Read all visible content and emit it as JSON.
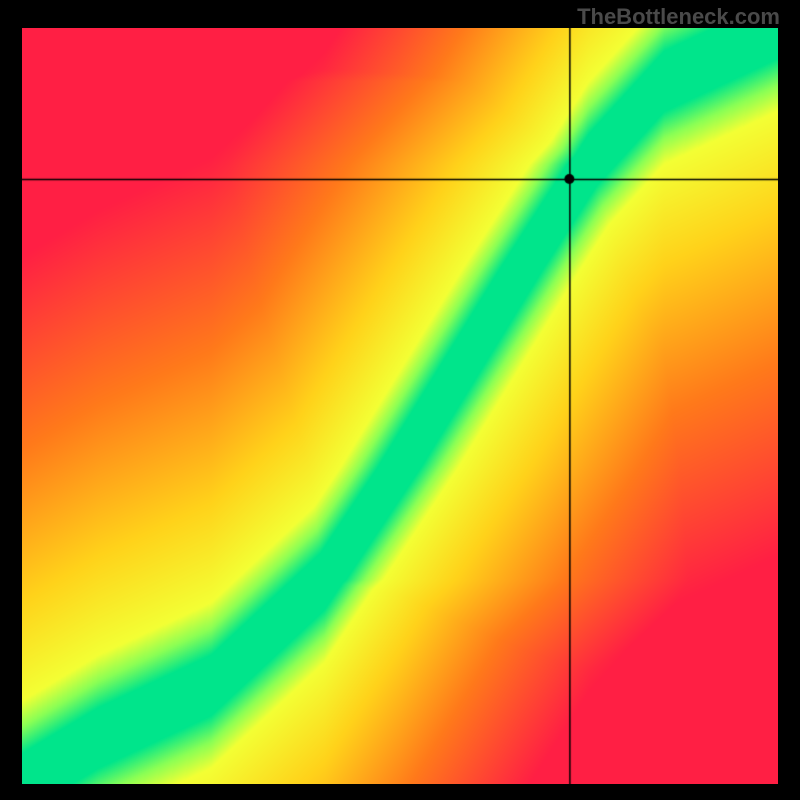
{
  "watermark": "TheBottleneck.com",
  "chart_data": {
    "type": "heatmap",
    "title": "",
    "xlabel": "",
    "ylabel": "",
    "xlim": [
      0,
      100
    ],
    "ylim": [
      0,
      100
    ],
    "crosshair": {
      "x": 72.5,
      "y": 80
    },
    "marker": {
      "x": 72.5,
      "y": 80,
      "radius": 5,
      "color": "#000000"
    },
    "ridge": {
      "description": "Green optimal band running from bottom-left to upper-right; curve is steeper than y=x in the lower half and closer to linear above ~50%.",
      "control_points": [
        {
          "x": 0,
          "y": 0
        },
        {
          "x": 10,
          "y": 6
        },
        {
          "x": 25,
          "y": 13
        },
        {
          "x": 40,
          "y": 27
        },
        {
          "x": 50,
          "y": 42
        },
        {
          "x": 58,
          "y": 55
        },
        {
          "x": 66,
          "y": 68
        },
        {
          "x": 75,
          "y": 82
        },
        {
          "x": 85,
          "y": 93
        },
        {
          "x": 100,
          "y": 100
        }
      ],
      "green_halfwidth_percent": 4.0,
      "yellow_halfwidth_percent": 11.0
    },
    "colormap": {
      "stops": [
        {
          "t": 0.0,
          "color": "#ff1f44"
        },
        {
          "t": 0.35,
          "color": "#ff7a1a"
        },
        {
          "t": 0.62,
          "color": "#ffd21a"
        },
        {
          "t": 0.8,
          "color": "#f3ff34"
        },
        {
          "t": 0.9,
          "color": "#8aff55"
        },
        {
          "t": 1.0,
          "color": "#00e58b"
        }
      ]
    }
  }
}
